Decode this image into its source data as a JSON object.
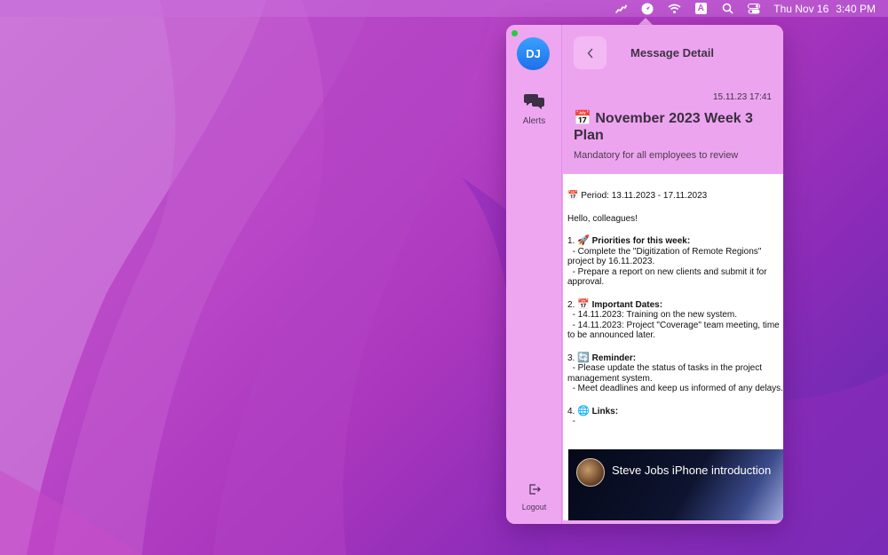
{
  "menubar": {
    "clock_day": "Thu Nov 16",
    "clock_time": "3:40 PM",
    "icons": [
      "app-dog-icon",
      "location-arrow-icon",
      "wifi-icon",
      "keyboard-input-a-icon",
      "spotlight-search-icon",
      "control-center-icon"
    ],
    "input_letter": "A"
  },
  "sidebar": {
    "avatar_initials": "DJ",
    "alerts_label": "Alerts",
    "logout_label": "Logout"
  },
  "header": {
    "title": "Message Detail",
    "date": "15.11.23 17:41",
    "message_title": "📅 November 2023 Week 3 Plan",
    "subtitle": "Mandatory for all employees to review"
  },
  "body": {
    "period": "📅 Period: 13.11.2023 - 17.11.2023",
    "greeting": "Hello, colleagues!",
    "section1_num": "1.",
    "section1_emoji": "🚀",
    "section1_title": "Priorities for this week:",
    "section1_item1": "  - Complete the \"Digitization of Remote Regions\" project by 16.11.2023.",
    "section1_item2": "  - Prepare a report on new clients and submit it for approval.",
    "section2_num": "2.",
    "section2_emoji": "📅",
    "section2_title": "Important Dates:",
    "section2_item1": "  - 14.11.2023: Training on the new system.",
    "section2_item2": "  - 14.11.2023: Project \"Coverage\" team meeting, time to be announced later.",
    "section3_num": "3.",
    "section3_emoji": "🔄",
    "section3_title": "Reminder:",
    "section3_item1": "  - Please update the status of tasks in the project management system.",
    "section3_item2": "  - Meet deadlines and keep us informed of any delays.",
    "section4_num": "4.",
    "section4_emoji": "🌐",
    "section4_title": "Links:",
    "section4_item1": "  -",
    "video_title": "Steve Jobs iPhone introduction"
  },
  "colors": {
    "popover_bg": "#f1a6f2",
    "avatar": "#2b86f5",
    "status_online": "#27c93f"
  }
}
